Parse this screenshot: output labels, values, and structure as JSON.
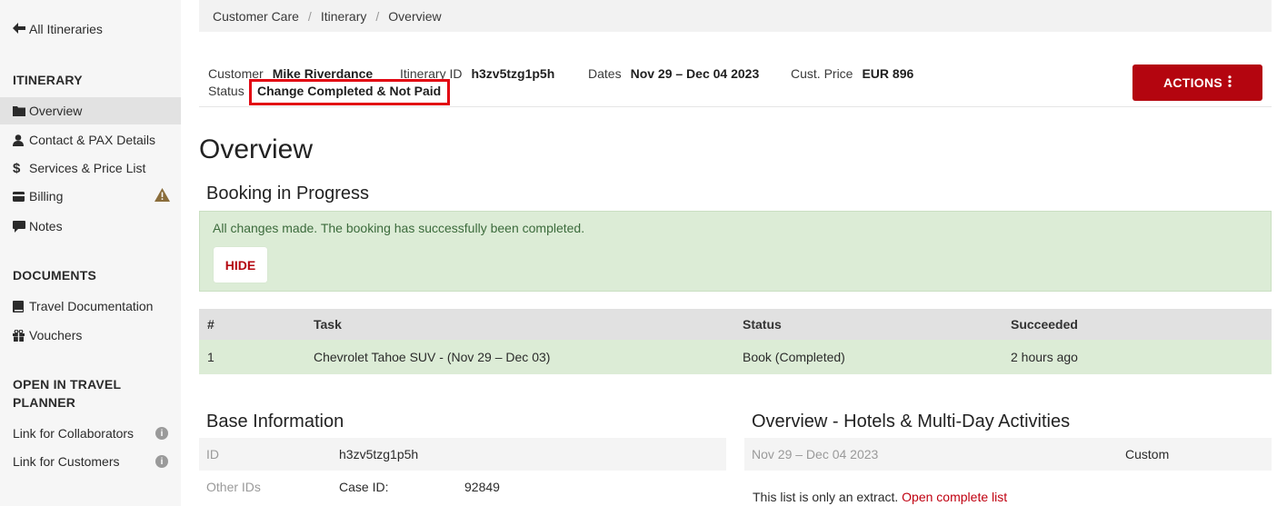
{
  "sidebar": {
    "back_label": "All Itineraries",
    "sections": {
      "itinerary": "ITINERARY",
      "documents": "DOCUMENTS",
      "travel_planner": [
        "OPEN IN TRAVEL",
        "PLANNER"
      ]
    },
    "itinerary_items": [
      {
        "label": "Overview",
        "icon": "folder-icon",
        "active": true
      },
      {
        "label": "Contact & PAX Details",
        "icon": "user-icon"
      },
      {
        "label": "Services & Price List",
        "icon": "dollar-icon"
      },
      {
        "label": "Billing",
        "icon": "credit-card-icon",
        "badge": "warning-icon"
      },
      {
        "label": "Notes",
        "icon": "comment-icon"
      }
    ],
    "document_items": [
      {
        "label": "Travel Documentation",
        "icon": "book-icon"
      },
      {
        "label": "Vouchers",
        "icon": "gift-icon"
      }
    ],
    "planner_items": [
      {
        "label": "Link for Collaborators",
        "badge": "info-icon"
      },
      {
        "label": "Link for Customers",
        "badge": "info-icon"
      }
    ],
    "info_glyph": "i"
  },
  "breadcrumb": [
    "Customer Care",
    "Itinerary",
    "Overview"
  ],
  "header": {
    "customer_label": "Customer",
    "customer_value": "Mike Riverdance",
    "itinerary_id_label": "Itinerary ID",
    "itinerary_id_value": "h3zv5tzg1p5h",
    "dates_label": "Dates",
    "dates_value": "Nov 29 – Dec 04 2023",
    "price_label": "Cust. Price",
    "price_value": "EUR 896",
    "status_label": "Status",
    "status_value": "Change Completed & Not Paid",
    "actions_label": "ACTIONS"
  },
  "main": {
    "title": "Overview",
    "booking_title": "Booking in Progress",
    "success_message": "All changes made. The booking has successfully been completed.",
    "hide_label": "HIDE",
    "task_table": {
      "headers": [
        "#",
        "Task",
        "Status",
        "Succeeded"
      ],
      "rows": [
        [
          "1",
          "Chevrolet Tahoe SUV - (Nov 29 – Dec 03)",
          "Book (Completed)",
          "2 hours ago"
        ]
      ]
    },
    "base_info": {
      "title": "Base Information",
      "rows": [
        {
          "key": "ID",
          "value": "h3zv5tzg1p5h"
        },
        {
          "key": "Other IDs",
          "value": "Case ID:",
          "value2": "92849"
        }
      ]
    },
    "hotels": {
      "title": "Overview - Hotels & Multi-Day Activities",
      "rows": [
        {
          "dates": "Nov 29 – Dec 04 2023",
          "type": "Custom"
        }
      ],
      "extract_note": "This list is only an extract.",
      "extract_link": "Open complete list"
    }
  },
  "colors": {
    "accent": "#b4050f",
    "success_bg": "#dcecd6",
    "highlight_border": "#e20613"
  }
}
